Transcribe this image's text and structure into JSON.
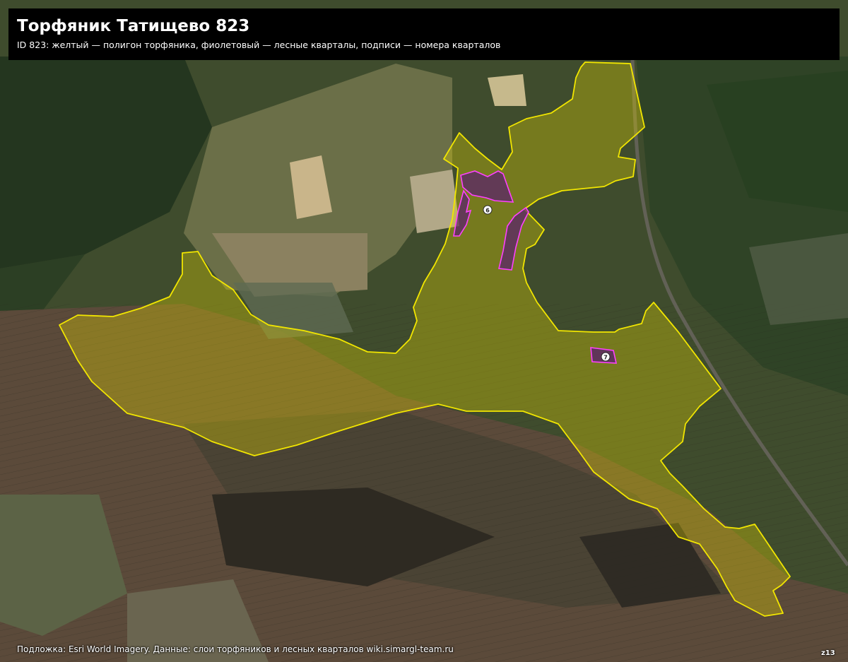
{
  "header": {
    "title": "Торфяник Татищево 823",
    "subtitle": "ID 823: желтый — полигон торфяника, фиолетовый — лесные кварталы, подписи — номера кварталов"
  },
  "map": {
    "peat_polygon_color": "#f2e600",
    "forest_quarter_color": "#ff40ff",
    "forest_quarter_fill": "#5a1f6e",
    "quarters": [
      {
        "label": "6"
      },
      {
        "label": "7"
      }
    ]
  },
  "footer": {
    "attribution": "Подложка: Esri World Imagery. Данные: слои торфяников и лесных кварталов wiki.simargl-team.ru",
    "zoom": "z13"
  }
}
